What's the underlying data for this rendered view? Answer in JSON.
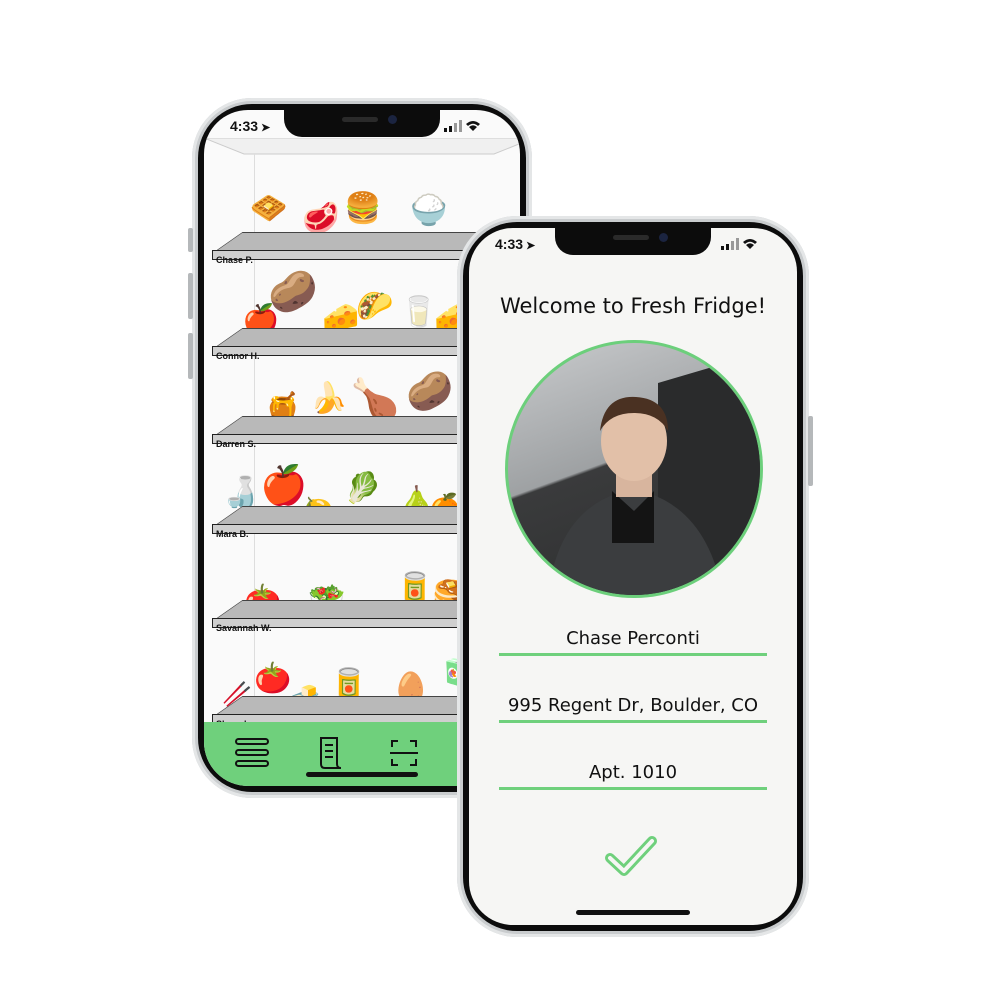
{
  "status_bar": {
    "time": "4:33"
  },
  "fridge": {
    "shelves": [
      {
        "label": "Chase P.",
        "items": [
          "🧇",
          "🥩",
          "🍔",
          "🍚"
        ]
      },
      {
        "label": "Connor H.",
        "items": [
          "🍎",
          "🥔",
          "🧀",
          "🌮",
          "🥛",
          "🧀"
        ]
      },
      {
        "label": "Darren S.",
        "items": [
          "🍯",
          "🍌",
          "🍗",
          "🥔"
        ]
      },
      {
        "label": "Mara B.",
        "items": [
          "🍶",
          "🍎",
          "🍋",
          "🥬",
          "🍐",
          "🍊"
        ]
      },
      {
        "label": "Savannah W.",
        "items": [
          "🍅",
          "🥗",
          "🥫",
          "🥞"
        ]
      },
      {
        "label": "Shared",
        "items": [
          "🥢",
          "🍅",
          "🧈",
          "🥫",
          "🥚",
          "🧃"
        ]
      }
    ],
    "nav": [
      "menu-icon",
      "receipt-icon",
      "scan-icon"
    ]
  },
  "profile": {
    "welcome": "Welcome to Fresh Fridge!",
    "name": "Chase Perconti",
    "address": "995 Regent Dr, Boulder, CO",
    "apartment": "Apt. 1010"
  },
  "colors": {
    "accent": "#6fd07c",
    "ring": "#6ccf7b"
  }
}
